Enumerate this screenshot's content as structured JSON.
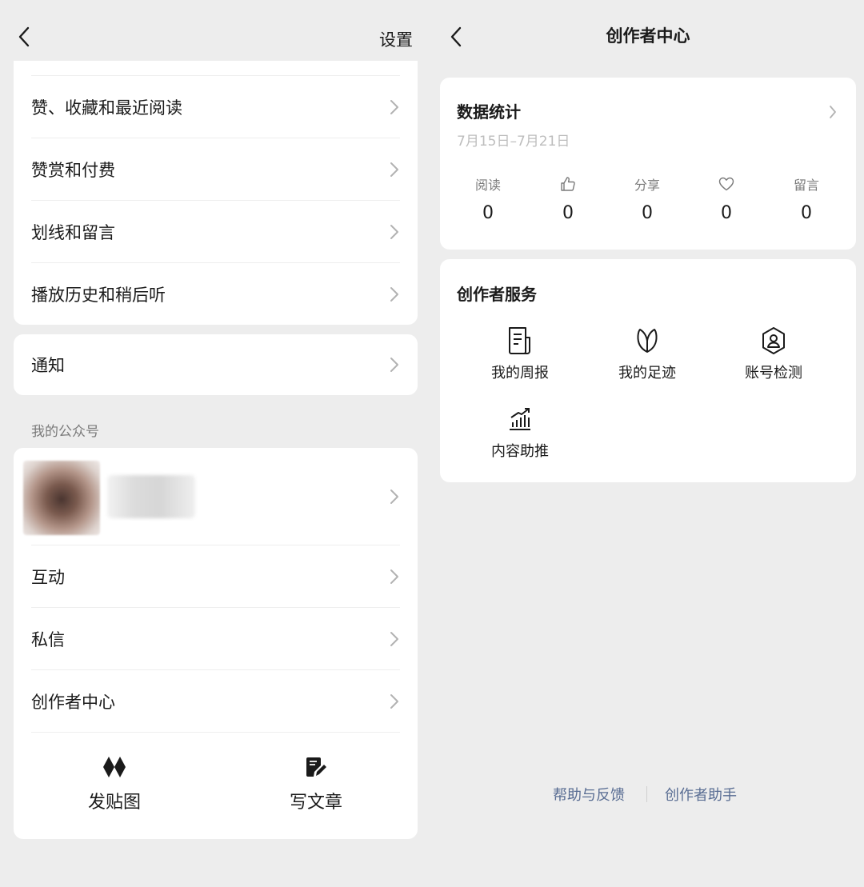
{
  "left": {
    "header": {
      "title": "设置"
    },
    "list_top": [
      {
        "label": "赞、收藏和最近阅读"
      },
      {
        "label": "赞赏和付费"
      },
      {
        "label": "划线和留言"
      },
      {
        "label": "播放历史和稍后听"
      }
    ],
    "notify": {
      "label": "通知"
    },
    "section_label": "我的公众号",
    "account_list": [
      {
        "label": "互动"
      },
      {
        "label": "私信"
      },
      {
        "label": "创作者中心"
      }
    ],
    "actions": [
      {
        "label": "发贴图",
        "icon": "diamond-pair-icon"
      },
      {
        "label": "写文章",
        "icon": "document-pen-icon"
      }
    ]
  },
  "right": {
    "header": {
      "title": "创作者中心"
    },
    "stats": {
      "title": "数据统计",
      "date_range": "7月15日–7月21日",
      "items": [
        {
          "label": "阅读",
          "value": "0"
        },
        {
          "icon": "thumbs-up-icon",
          "value": "0"
        },
        {
          "label": "分享",
          "value": "0"
        },
        {
          "icon": "heart-icon",
          "value": "0"
        },
        {
          "label": "留言",
          "value": "0"
        }
      ]
    },
    "services": {
      "title": "创作者服务",
      "items": [
        {
          "label": "我的周报",
          "icon": "weekly-report-icon"
        },
        {
          "label": "我的足迹",
          "icon": "leaf-icon"
        },
        {
          "label": "账号检测",
          "icon": "account-shield-icon"
        },
        {
          "label": "内容助推",
          "icon": "growth-chart-icon"
        }
      ]
    },
    "footer": {
      "help": "帮助与反馈",
      "assistant": "创作者助手"
    }
  }
}
